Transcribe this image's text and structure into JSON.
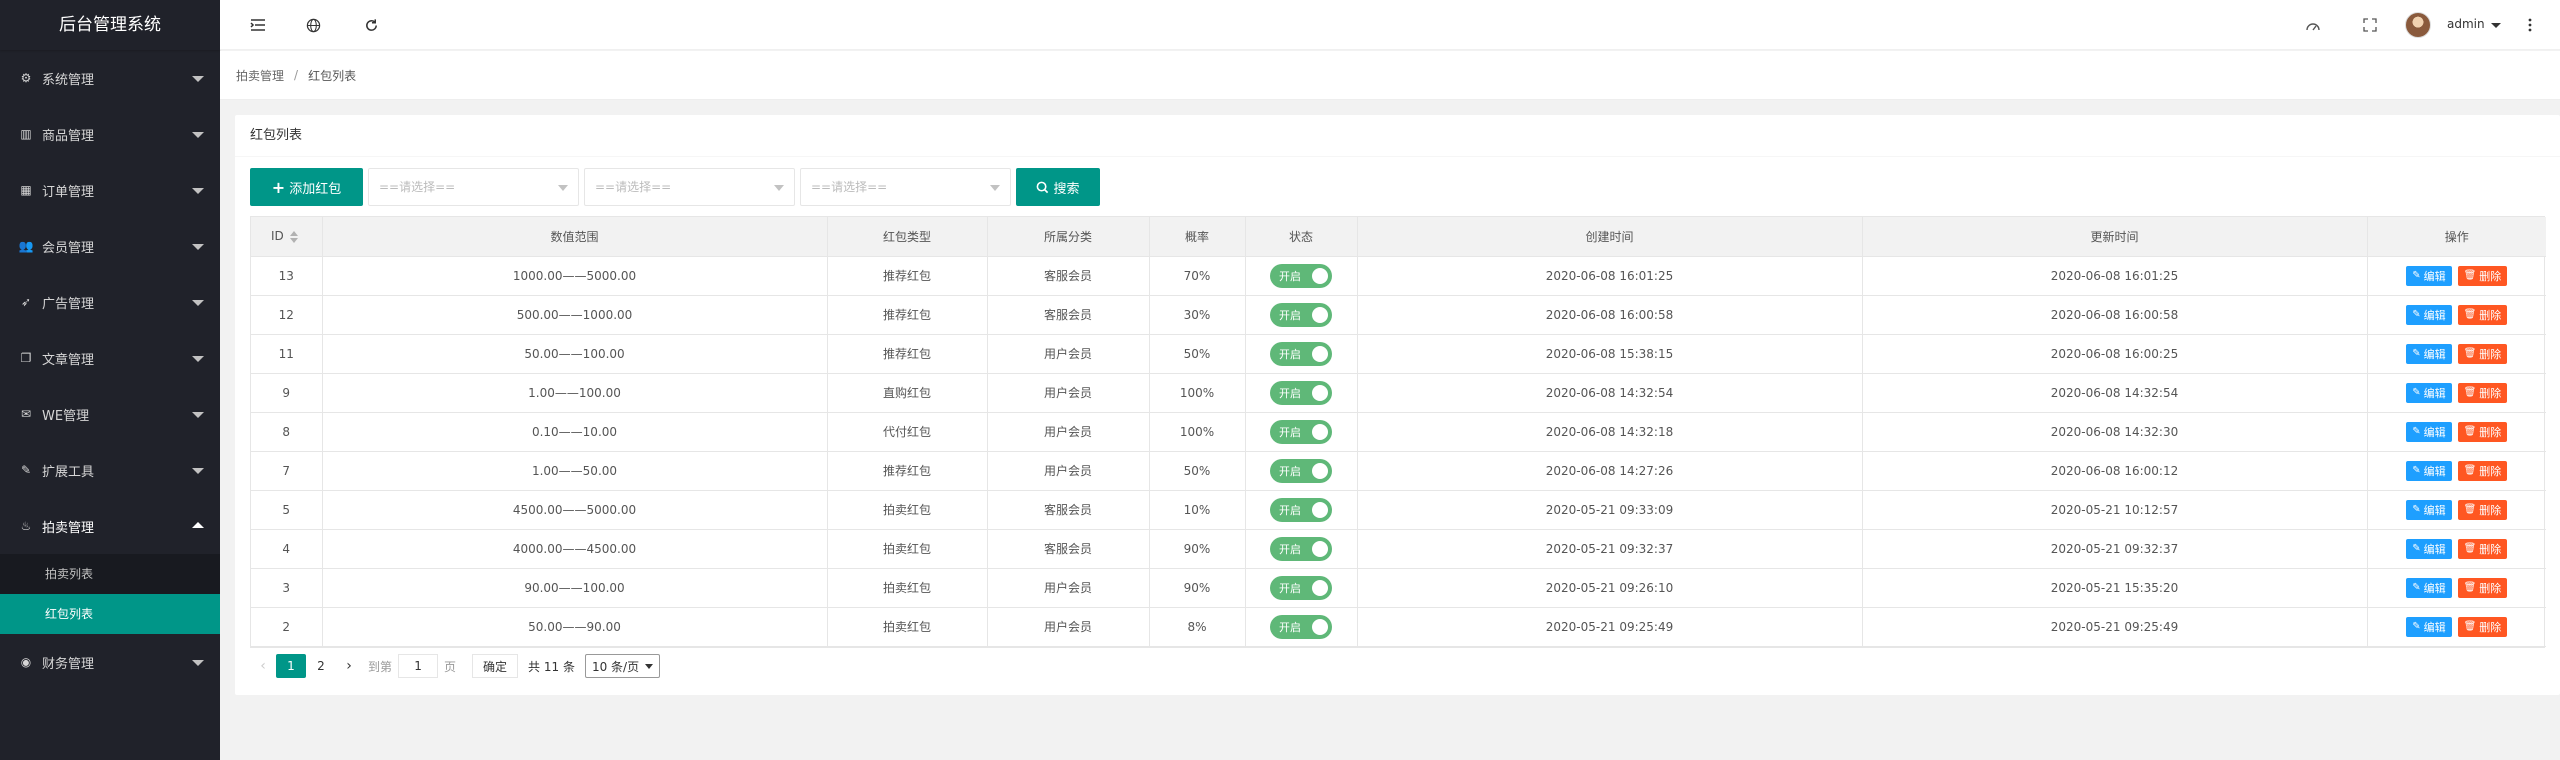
{
  "app": {
    "title": "后台管理系统"
  },
  "sidebar": {
    "items": [
      {
        "label": "系统管理",
        "icon": "gear-icon"
      },
      {
        "label": "商品管理",
        "icon": "bar-chart-icon"
      },
      {
        "label": "订单管理",
        "icon": "calendar-icon"
      },
      {
        "label": "会员管理",
        "icon": "users-icon"
      },
      {
        "label": "广告管理",
        "icon": "rocket-icon"
      },
      {
        "label": "文章管理",
        "icon": "copy-icon"
      },
      {
        "label": "WE管理",
        "icon": "chat-icon"
      },
      {
        "label": "扩展工具",
        "icon": "wrench-icon"
      },
      {
        "label": "拍卖管理",
        "icon": "fire-icon"
      },
      {
        "label": "财务管理",
        "icon": "coin-icon"
      }
    ],
    "submenu": [
      {
        "label": "拍卖列表"
      },
      {
        "label": "红包列表"
      }
    ]
  },
  "header": {
    "user": "admin"
  },
  "breadcrumb": {
    "parent": "拍卖管理",
    "separator": "/",
    "current": "红包列表"
  },
  "card": {
    "title": "红包列表"
  },
  "toolbar": {
    "add_label": "添加红包",
    "select_placeholder": "==请选择==",
    "search_label": "搜索"
  },
  "table": {
    "headers": [
      "ID",
      "数值范围",
      "红包类型",
      "所属分类",
      "概率",
      "状态",
      "创建时间",
      "更新时间",
      "操作"
    ],
    "status_label": "开启",
    "edit_label": "编辑",
    "delete_label": "删除",
    "rows": [
      {
        "id": "13",
        "range": "1000.00——5000.00",
        "type": "推荐红包",
        "category": "客服会员",
        "rate": "70%",
        "created": "2020-06-08 16:01:25",
        "updated": "2020-06-08 16:01:25"
      },
      {
        "id": "12",
        "range": "500.00——1000.00",
        "type": "推荐红包",
        "category": "客服会员",
        "rate": "30%",
        "created": "2020-06-08 16:00:58",
        "updated": "2020-06-08 16:00:58"
      },
      {
        "id": "11",
        "range": "50.00——100.00",
        "type": "推荐红包",
        "category": "用户会员",
        "rate": "50%",
        "created": "2020-06-08 15:38:15",
        "updated": "2020-06-08 16:00:25"
      },
      {
        "id": "9",
        "range": "1.00——100.00",
        "type": "直购红包",
        "category": "用户会员",
        "rate": "100%",
        "created": "2020-06-08 14:32:54",
        "updated": "2020-06-08 14:32:54"
      },
      {
        "id": "8",
        "range": "0.10——10.00",
        "type": "代付红包",
        "category": "用户会员",
        "rate": "100%",
        "created": "2020-06-08 14:32:18",
        "updated": "2020-06-08 14:32:30"
      },
      {
        "id": "7",
        "range": "1.00——50.00",
        "type": "推荐红包",
        "category": "用户会员",
        "rate": "50%",
        "created": "2020-06-08 14:27:26",
        "updated": "2020-06-08 16:00:12"
      },
      {
        "id": "5",
        "range": "4500.00——5000.00",
        "type": "拍卖红包",
        "category": "客服会员",
        "rate": "10%",
        "created": "2020-05-21 09:33:09",
        "updated": "2020-05-21 10:12:57"
      },
      {
        "id": "4",
        "range": "4000.00——4500.00",
        "type": "拍卖红包",
        "category": "客服会员",
        "rate": "90%",
        "created": "2020-05-21 09:32:37",
        "updated": "2020-05-21 09:32:37"
      },
      {
        "id": "3",
        "range": "90.00——100.00",
        "type": "拍卖红包",
        "category": "用户会员",
        "rate": "90%",
        "created": "2020-05-21 09:26:10",
        "updated": "2020-05-21 15:35:20"
      },
      {
        "id": "2",
        "range": "50.00——90.00",
        "type": "拍卖红包",
        "category": "用户会员",
        "rate": "8%",
        "created": "2020-05-21 09:25:49",
        "updated": "2020-05-21 09:25:49"
      }
    ]
  },
  "pager": {
    "prev": "‹",
    "pages": [
      "1",
      "2"
    ],
    "next": "›",
    "goto_label": "到第",
    "page_value": "1",
    "page_unit": "页",
    "confirm_label": "确定",
    "total": "共 11 条",
    "page_size": "10 条/页"
  },
  "colors": {
    "primary": "#009688",
    "sidebar": "#20222a",
    "switch_on": "#5FB878",
    "edit": "#1E9FFF",
    "delete": "#FF5722"
  }
}
